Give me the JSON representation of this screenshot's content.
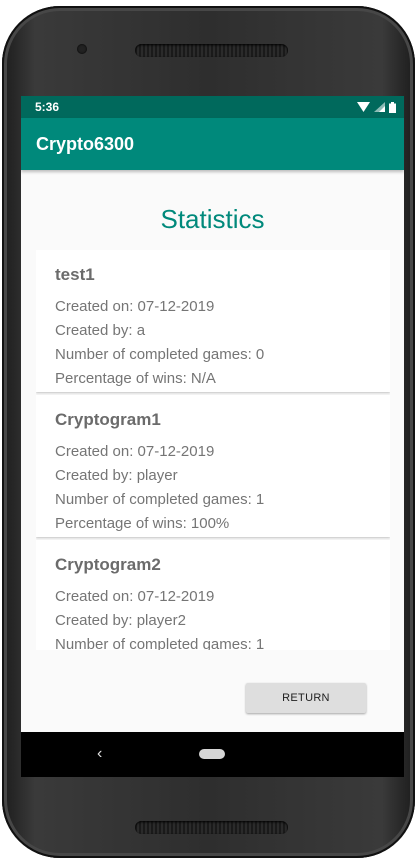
{
  "status_bar": {
    "time": "5:36",
    "icons": [
      "wifi-icon",
      "signal-icon",
      "battery-icon"
    ]
  },
  "app_bar": {
    "title": "Crypto6300"
  },
  "page": {
    "title": "Statistics"
  },
  "stats": [
    {
      "name": "test1",
      "created_on": "Created on: 07-12-2019",
      "created_by": "Created by: a",
      "completed_games": "Number of completed games: 0",
      "win_percentage": "Percentage of wins: N/A"
    },
    {
      "name": "Cryptogram1",
      "created_on": "Created on: 07-12-2019",
      "created_by": "Created by: player",
      "completed_games": "Number of completed games: 1",
      "win_percentage": "Percentage of wins: 100%"
    },
    {
      "name": "Cryptogram2",
      "created_on": "Created on: 07-12-2019",
      "created_by": "Created by: player2",
      "completed_games": "Number of completed games: 1"
    }
  ],
  "actions": {
    "return_label": "RETURN"
  },
  "nav": {
    "back_glyph": "‹",
    "icons": [
      "back-icon",
      "home-icon"
    ]
  },
  "colors": {
    "status_bar": "#00695C",
    "app_bar": "#00897B",
    "accent": "#00897B",
    "button": "#DEDEDE"
  }
}
